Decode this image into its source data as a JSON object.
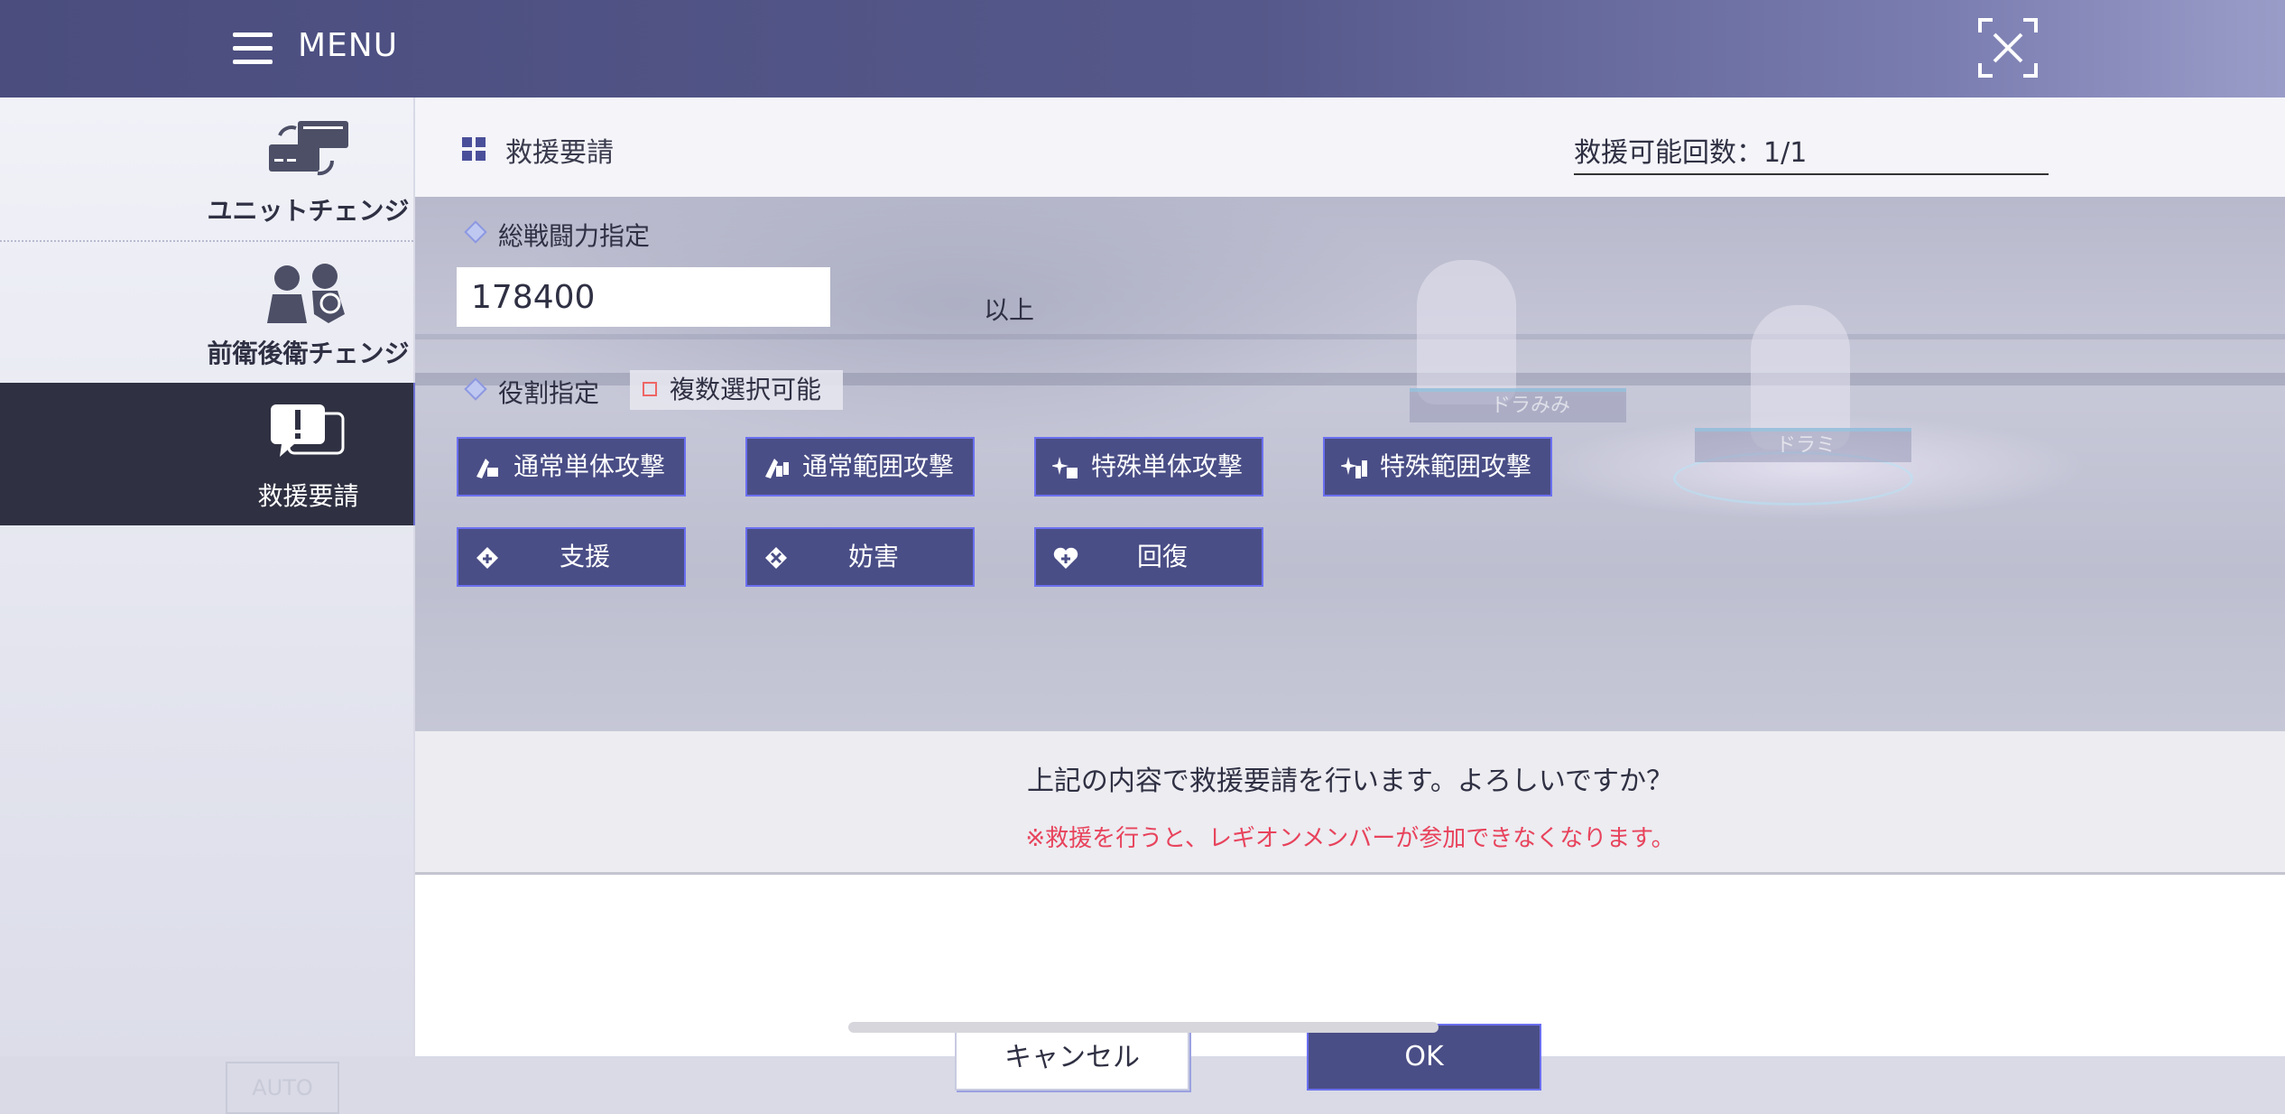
{
  "header": {
    "menu_label": "MENU",
    "icons": {
      "menu": "hamburger-icon",
      "close": "close-icon"
    }
  },
  "sidebar": {
    "items": [
      {
        "label": "ユニットチェンジ",
        "icon": "unit-change-icon",
        "active": false
      },
      {
        "label": "前衛後衛チェンジ",
        "icon": "position-change-icon",
        "active": false
      },
      {
        "label": "救援要請",
        "icon": "rescue-request-icon",
        "active": true
      }
    ],
    "faded_button": "AUTO"
  },
  "main": {
    "title": "救援要請",
    "rescue_count": "救援可能回数：1/1",
    "power": {
      "label": "総戦闘力指定",
      "value": "178400",
      "suffix": "以上"
    },
    "roles": {
      "label": "役割指定",
      "multi_select": "複数選択可能",
      "buttons": [
        {
          "label": "通常単体攻撃",
          "icon": "normal-single-attack-icon"
        },
        {
          "label": "通常範囲攻撃",
          "icon": "normal-area-attack-icon"
        },
        {
          "label": "特殊単体攻撃",
          "icon": "special-single-attack-icon"
        },
        {
          "label": "特殊範囲攻撃",
          "icon": "special-area-attack-icon"
        },
        {
          "label": "支援",
          "icon": "support-icon"
        },
        {
          "label": "妨害",
          "icon": "obstruct-icon"
        },
        {
          "label": "回復",
          "icon": "heal-icon"
        }
      ]
    },
    "background_tags": [
      "ドラみみ",
      "ドラミ"
    ],
    "confirm": {
      "question": "上記の内容で救援要請を行います。よろしいですか？",
      "warning": "※救援を行うと、レギオンメンバーが参加できなくなります。"
    },
    "actions": {
      "cancel": "キャンセル",
      "ok": "OK"
    }
  },
  "colors": {
    "header": "#4a4d7e",
    "button": "#4a4e86",
    "button_border": "#6b6ff0",
    "warning": "#e8435c",
    "sidebar_active": "#2f3142"
  }
}
